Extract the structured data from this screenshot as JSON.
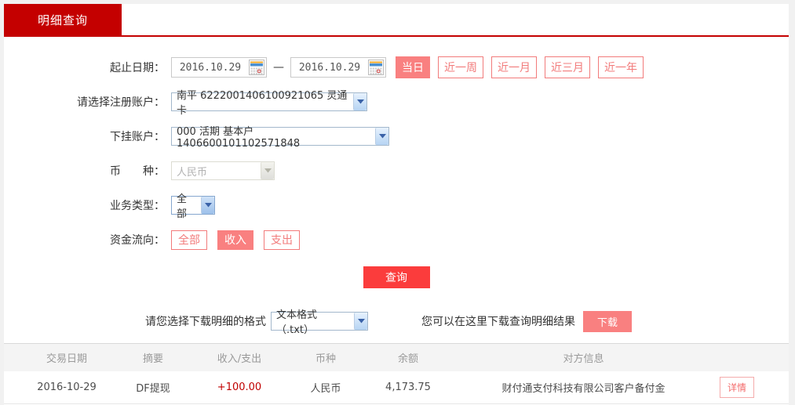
{
  "colors": {
    "tab_red": "#c40000",
    "query_red": "#fb3c3c",
    "salmon": "#f98080",
    "amount_red": "#c00000"
  },
  "tab": {
    "label": "明细查询"
  },
  "form": {
    "date": {
      "label": "起止日期：",
      "from": "2016.10.29",
      "to": "2016.10.29",
      "separator": "—"
    },
    "quick_ranges": [
      {
        "label": "当日",
        "active": true
      },
      {
        "label": "近一周",
        "active": false
      },
      {
        "label": "近一月",
        "active": false
      },
      {
        "label": "近三月",
        "active": false
      },
      {
        "label": "近一年",
        "active": false
      }
    ],
    "register_account": {
      "label": "请选择注册账户：",
      "value": "南平 6222001406100921065 灵通卡"
    },
    "sub_account": {
      "label": "下挂账户：",
      "value": "000 活期 基本户 1406600101102571848"
    },
    "currency": {
      "label": "币　　种：",
      "value": "人民币",
      "disabled": true
    },
    "biz_type": {
      "label": "业务类型：",
      "value": "全部"
    },
    "fund_flow": {
      "label": "资金流向：",
      "options": [
        {
          "label": "全部",
          "active": false
        },
        {
          "label": "收入",
          "active": true
        },
        {
          "label": "支出",
          "active": false
        }
      ]
    },
    "query_button": "查询"
  },
  "download": {
    "format_label": "请您选择下载明细的格式",
    "format_value": "文本格式（.txt）",
    "hint": "您可以在这里下载查询明细结果",
    "button": "下载"
  },
  "table": {
    "headers": [
      "交易日期",
      "摘要",
      "收入/支出",
      "币种",
      "余额",
      "对方信息"
    ],
    "rows": [
      {
        "date": "2016-10-29",
        "summary": "DF提现",
        "amount": "+100.00",
        "currency": "人民币",
        "balance": "4,173.75",
        "party": "财付通支付科技有限公司客户备付金",
        "action": "详情"
      }
    ]
  }
}
